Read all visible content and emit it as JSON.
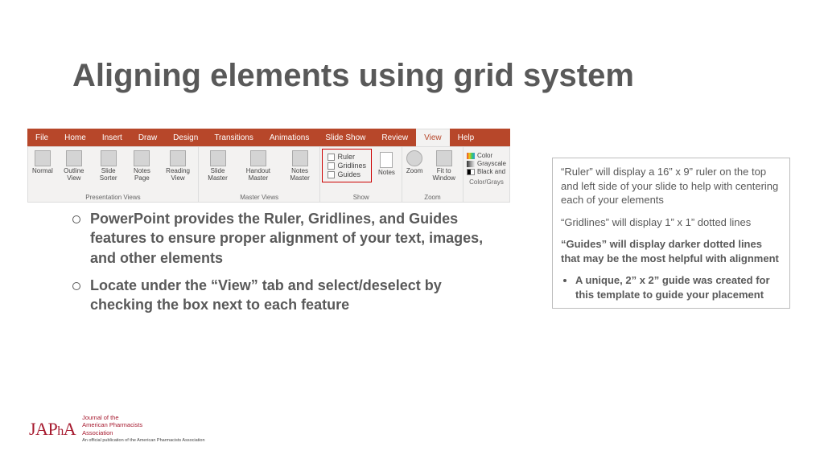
{
  "title": "Aligning elements using grid system",
  "ribbon": {
    "tabs": [
      "File",
      "Home",
      "Insert",
      "Draw",
      "Design",
      "Transitions",
      "Animations",
      "Slide Show",
      "Review",
      "View",
      "Help"
    ],
    "active_tab": "View",
    "groups": {
      "presentation_views": {
        "label": "Presentation Views",
        "items": [
          "Normal",
          "Outline View",
          "Slide Sorter",
          "Notes Page",
          "Reading View"
        ]
      },
      "master_views": {
        "label": "Master Views",
        "items": [
          "Slide Master",
          "Handout Master",
          "Notes Master"
        ]
      },
      "show": {
        "label": "Show",
        "items": [
          "Ruler",
          "Gridlines",
          "Guides"
        ],
        "notes": "Notes"
      },
      "zoom": {
        "label": "Zoom",
        "items": [
          "Zoom",
          "Fit to Window"
        ]
      },
      "color_grayscale": {
        "label": "Color/Grays",
        "items": [
          "Color",
          "Grayscale",
          "Black and"
        ]
      }
    }
  },
  "bullets": [
    "PowerPoint provides the Ruler, Gridlines, and Guides features to ensure proper alignment of your text, images, and other elements",
    "Locate under the “View” tab and select/deselect by checking the box next to each feature"
  ],
  "side": {
    "p1": "“Ruler” will display a 16” x 9” ruler on the top and left side of your slide to help with centering each of your elements",
    "p2": "“Gridlines” will display 1” x 1” dotted lines",
    "p3": "“Guides” will display darker dotted lines that may be the most helpful with alignment",
    "li": "A unique, 2” x 2” guide was created for this template to guide your placement"
  },
  "logo": {
    "mark_pre": "JAP",
    "mark_ph": "h",
    "mark_post": "A",
    "line1": "Journal of the",
    "line2": "American Pharmacists",
    "line3": "Association",
    "small": "An official publication of the American Pharmacists Association"
  }
}
